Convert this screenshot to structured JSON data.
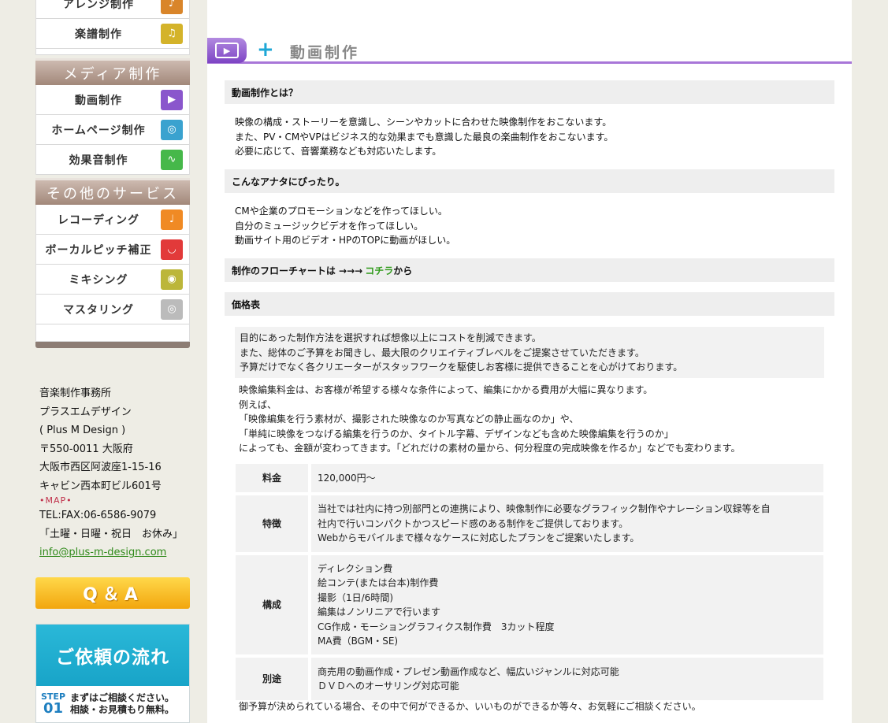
{
  "sidebar": {
    "music_items": [
      {
        "label": "アレンジ制作",
        "icon": "guitar-icon",
        "color": "#d9852a"
      },
      {
        "label": "楽譜制作",
        "icon": "score-icon",
        "color": "#d4b32a"
      }
    ],
    "media_header": "メディア制作",
    "media_items": [
      {
        "label": "動画制作",
        "icon": "film-icon",
        "color": "#8a56cc"
      },
      {
        "label": "ホームページ制作",
        "icon": "globe-icon",
        "color": "#3aa2cf"
      },
      {
        "label": "効果音制作",
        "icon": "waveform-icon",
        "color": "#46b84a"
      }
    ],
    "other_header": "その他のサービス",
    "other_items": [
      {
        "label": "レコーディング",
        "icon": "microphone-icon",
        "color": "#f08a24"
      },
      {
        "label": "ボーカルピッチ補正",
        "icon": "lips-icon",
        "color": "#e23a3a"
      },
      {
        "label": "ミキシング",
        "icon": "disc-icon",
        "color": "#bcb63a"
      },
      {
        "label": "マスタリング",
        "icon": "cd-icon",
        "color": "#bbbbbb"
      }
    ]
  },
  "company": {
    "line1": "音楽制作事務所",
    "name": "プラスエムデザイン",
    "name_en": "( Plus M Design )",
    "postal": "〒550-0011 大阪府",
    "address1": "大阪市西区阿波座1-15-16",
    "address2": "キャビン西本町ビル601号",
    "map": "•MAP•",
    "tel": "TEL:FAX:06-6586-9079",
    "holiday": "「土曜・日曜・祝日　お休み」",
    "email": "info@plus-m-design.com"
  },
  "qa_label": "Q＆A",
  "flow_banner": {
    "title": "ご依頼の流れ",
    "step_label": "STEP",
    "step_no": "01",
    "step_line1": "まずはご相談ください。",
    "step_line2": "相談・お見積もり無料。"
  },
  "main": {
    "title": "動画制作",
    "sections": {
      "what": {
        "heading": "動画制作とは？",
        "lines": [
          "映像の構成・ストーリーを意識し、シーンやカットに合わせた映像制作をおこないます。",
          "また、PV・CMやVPはビジネス的な効果までも意識した最良の楽曲制作をおこないます。",
          "必要に応じて、音響業務なども対応いたします。"
        ]
      },
      "target": {
        "heading": "こんなアナタにぴったり。",
        "lines": [
          "CMや企業のプロモーションなどを作ってほしい。",
          "自分のミュージックビデオを作ってほしい。",
          "動画サイト用のビデオ・HPのTOPに動画がほしい。"
        ]
      },
      "flow": {
        "prefix": "制作のフローチャートは →→→",
        "link": "コチラ",
        "suffix": "から"
      },
      "price": {
        "heading": "価格表",
        "intro": [
          "目的にあった制作方法を選択すれば想像以上にコストを削減できます。",
          "また、総体のご予算をお聞きし、最大限のクリエイティブレベルをご提案させていただきます。",
          "予算だけでなく各クリエーターがスタッフワークを駆使しお客様に提供できることを心がけております。"
        ],
        "desc": [
          "映像編集料金は、お客様が希望する様々な条件によって、編集にかかる費用が大幅に異なります。",
          "例えば、",
          "「映像編集を行う素材が、撮影された映像なのか写真などの静止画なのか」や、",
          "「単純に映像をつなげる編集を行うのか、タイトル字幕、デザインなども含めた映像編集を行うのか」",
          "によっても、金額が変わってきます。「どれだけの素材の量から、何分程度の完成映像を作るか」などでも変わります。"
        ],
        "table": [
          {
            "label": "料金",
            "lines": [
              "120,000円〜"
            ]
          },
          {
            "label": "特徴",
            "lines": [
              "当社では社内に持つ別部門との連携により、映像制作に必要なグラフィック制作やナレーション収録等を自",
              "社内で行いコンパクトかつスピード感のある制作をご提供しております。",
              "Webからモバイルまで様々なケースに対応したプランをご提案いたします。"
            ]
          },
          {
            "label": "構成",
            "lines": [
              "ディレクション費",
              "絵コンテ(または台本)制作費",
              "撮影（1日/6時間)",
              "編集はノンリニアで行います",
              "CG作成・モーショングラフィクス制作費　3カット程度",
              "MA費（BGM・SE)"
            ]
          },
          {
            "label": "別途",
            "lines": [
              "商売用の動画作成・プレゼン動画作成など、幅広いジャンルに対応可能",
              "ＤＶＤへのオーサリング対応可能"
            ]
          }
        ],
        "closing": "御予算が決められている場合、その中で何ができるか、いいものができるか等々、お気軽にご相談ください。"
      }
    }
  }
}
